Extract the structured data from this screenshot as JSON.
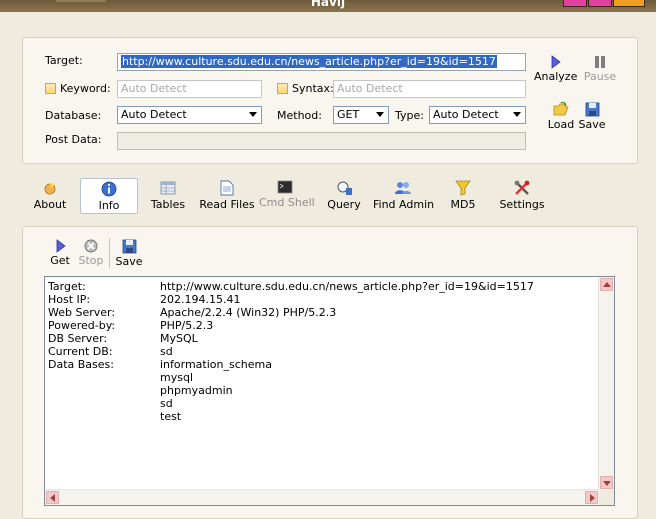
{
  "window": {
    "title": "Havij"
  },
  "form": {
    "target_label": "Target:",
    "target_value": "http://www.culture.sdu.edu.cn/news_article.php?er_id=19&id=1517",
    "keyword_label": "Keyword:",
    "keyword_placeholder": "Auto Detect",
    "syntax_label": "Syntax:",
    "syntax_placeholder": "Auto Detect",
    "database_label": "Database:",
    "database_value": "Auto Detect",
    "method_label": "Method:",
    "method_value": "GET",
    "type_label": "Type:",
    "type_value": "Auto Detect",
    "postdata_label": "Post Data:"
  },
  "actions": {
    "analyze": "Analyze",
    "pause": "Pause",
    "load": "Load",
    "save": "Save"
  },
  "tabs": [
    "About",
    "Info",
    "Tables",
    "Read Files",
    "Cmd Shell",
    "Query",
    "Find Admin",
    "MD5",
    "Settings"
  ],
  "active_tab": "Info",
  "info_toolbar": {
    "get": "Get",
    "stop": "Stop",
    "save": "Save"
  },
  "info": {
    "rows": [
      {
        "key": "Target:",
        "value": "http://www.culture.sdu.edu.cn/news_article.php?er_id=19&id=1517"
      },
      {
        "key": "Host IP:",
        "value": "202.194.15.41"
      },
      {
        "key": "Web Server:",
        "value": "Apache/2.2.4 (Win32) PHP/5.2.3"
      },
      {
        "key": "Powered-by:",
        "value": "PHP/5.2.3"
      },
      {
        "key": "DB Server:",
        "value": "MySQL"
      },
      {
        "key": "Current DB:",
        "value": "sd"
      },
      {
        "key": "Data Bases:",
        "value": "information_schema"
      },
      {
        "key": "",
        "value": "mysql"
      },
      {
        "key": "",
        "value": "phpmyadmin"
      },
      {
        "key": "",
        "value": "sd"
      },
      {
        "key": "",
        "value": "test"
      }
    ]
  },
  "colors": {
    "background": "#efecdf",
    "selection": "#3168c2",
    "accent_pink": "#e040a0"
  }
}
